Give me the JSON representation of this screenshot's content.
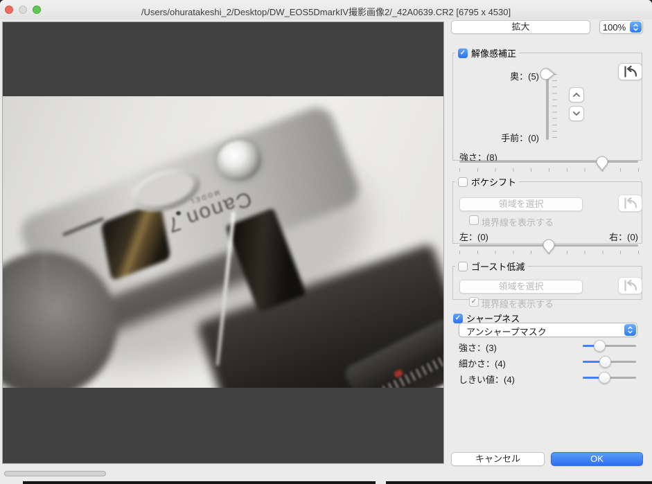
{
  "window": {
    "title": "/Users/ohuratakeshi_2/Desktop/DW_EOS5DmarkIV撮影画像2/_42A0639.CR2 [6795 x 4530]"
  },
  "toolbar": {
    "zoom_button_label": "拡大",
    "zoom_level": "100%"
  },
  "sections": {
    "resolution": {
      "label": "解像感補正",
      "checked": true,
      "back_label": "奥：(5)",
      "back_value": 5,
      "front_label": "手前：(0)",
      "front_value": 0,
      "strength_label": "強さ：(8)",
      "strength_value": 8
    },
    "bokeh": {
      "label": "ボケシフト",
      "checked": false,
      "select_area_label": "領域を選択",
      "show_border_label": "境界線を表示する",
      "show_border_checked": false,
      "left_label": "左：(0)",
      "left_value": 0,
      "right_label": "右：(0)",
      "right_value": 0
    },
    "ghost": {
      "label": "ゴースト低減",
      "checked": false,
      "select_area_label": "領域を選択",
      "show_border_label": "境界線を表示する",
      "show_border_checked": true
    },
    "sharpness": {
      "label": "シャープネス",
      "checked": true,
      "method": "アンシャープマスク",
      "strength_label": "強さ：(3)",
      "strength_value": 3,
      "fineness_label": "細かさ：(4)",
      "fineness_value": 4,
      "threshold_label": "しきい値：(4)",
      "threshold_value": 4
    }
  },
  "footer": {
    "cancel_label": "キャンセル",
    "ok_label": "OK"
  },
  "photo": {
    "engraving_line1": "Canon 7",
    "engraving_line2": "MODEL"
  },
  "icons": {
    "checkmark": "✓"
  },
  "colors": {
    "accent_blue": "#3478f6",
    "ok_button_blue": "#3b7df5",
    "letterbox_gray": "#414141",
    "photo_background": "#e8e7e3"
  }
}
